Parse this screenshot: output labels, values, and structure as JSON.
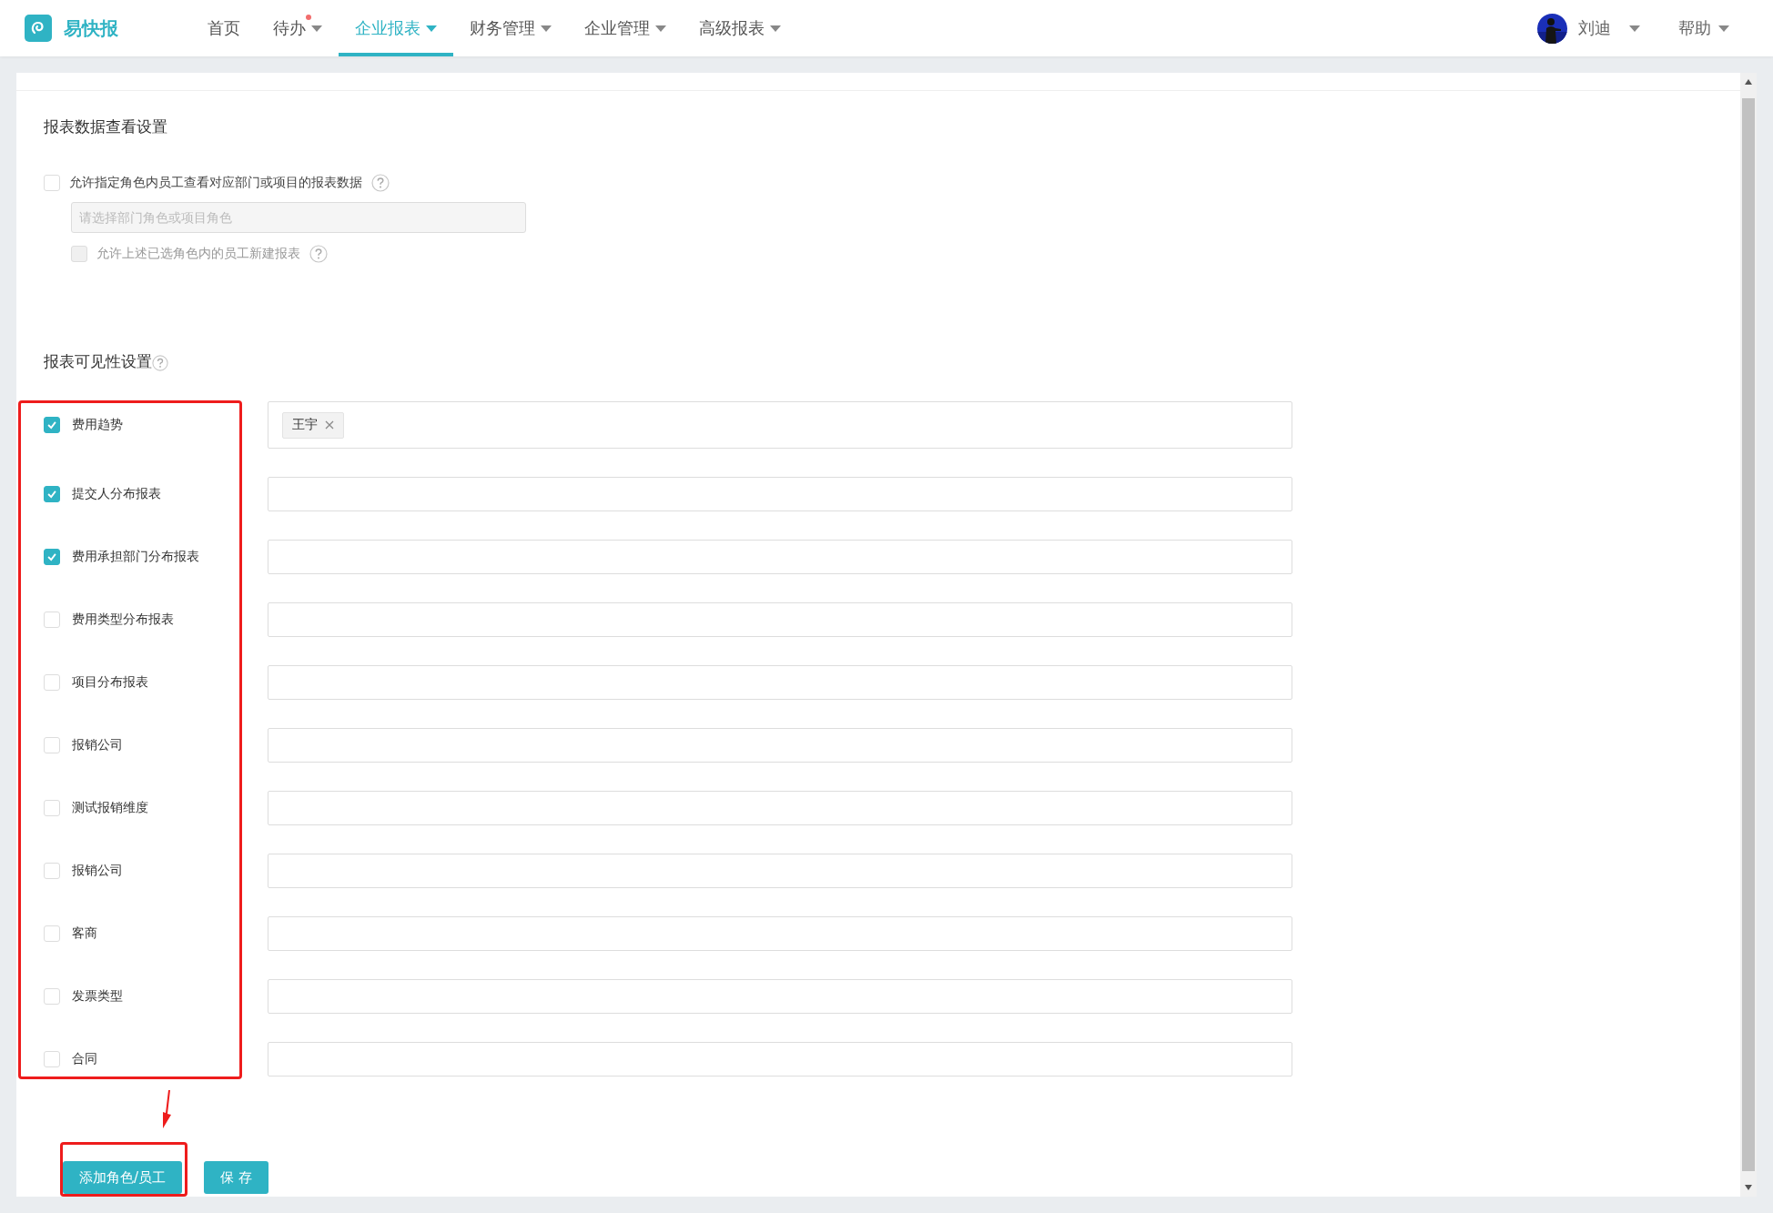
{
  "app": {
    "name": "易快报"
  },
  "nav": [
    {
      "label": "首页",
      "selected": false,
      "dropdown": false,
      "badge": false
    },
    {
      "label": "待办",
      "selected": false,
      "dropdown": true,
      "badge": true
    },
    {
      "label": "企业报表",
      "selected": true,
      "dropdown": true,
      "badge": false
    },
    {
      "label": "财务管理",
      "selected": false,
      "dropdown": true,
      "badge": false
    },
    {
      "label": "企业管理",
      "selected": false,
      "dropdown": true,
      "badge": false
    },
    {
      "label": "高级报表",
      "selected": false,
      "dropdown": true,
      "badge": false
    }
  ],
  "user": {
    "name": "刘迪"
  },
  "help": {
    "label": "帮助"
  },
  "data_view": {
    "title": "报表数据查看设置",
    "allow": {
      "label": "允许指定角色内员工查看对应部门或项目的报表数据",
      "checked": false
    },
    "role_select": {
      "placeholder": "请选择部门角色或项目角色",
      "disabled": true
    },
    "allow_create": {
      "label": "允许上述已选角色内的员工新建报表",
      "checked": false,
      "disabled": true
    }
  },
  "visibility": {
    "title": "报表可见性设置",
    "highlighted": true,
    "reports": [
      {
        "name": "费用趋势",
        "checked": true,
        "tags": [
          "王宇"
        ]
      },
      {
        "name": "提交人分布报表",
        "checked": true
      },
      {
        "name": "费用承担部门分布报表",
        "checked": true
      },
      {
        "name": "费用类型分布报表",
        "checked": false
      },
      {
        "name": "项目分布报表",
        "checked": false
      },
      {
        "name": "报销公司",
        "checked": false
      },
      {
        "name": "测试报销维度",
        "checked": false
      },
      {
        "name": "报销公司",
        "checked": false
      },
      {
        "name": "客商",
        "checked": false
      },
      {
        "name": "发票类型",
        "checked": false
      },
      {
        "name": "合同",
        "checked": false
      }
    ]
  },
  "buttons": [
    {
      "label": "添加角色/员工",
      "highlighted": true
    },
    {
      "label": "保 存",
      "highlighted": false
    }
  ]
}
